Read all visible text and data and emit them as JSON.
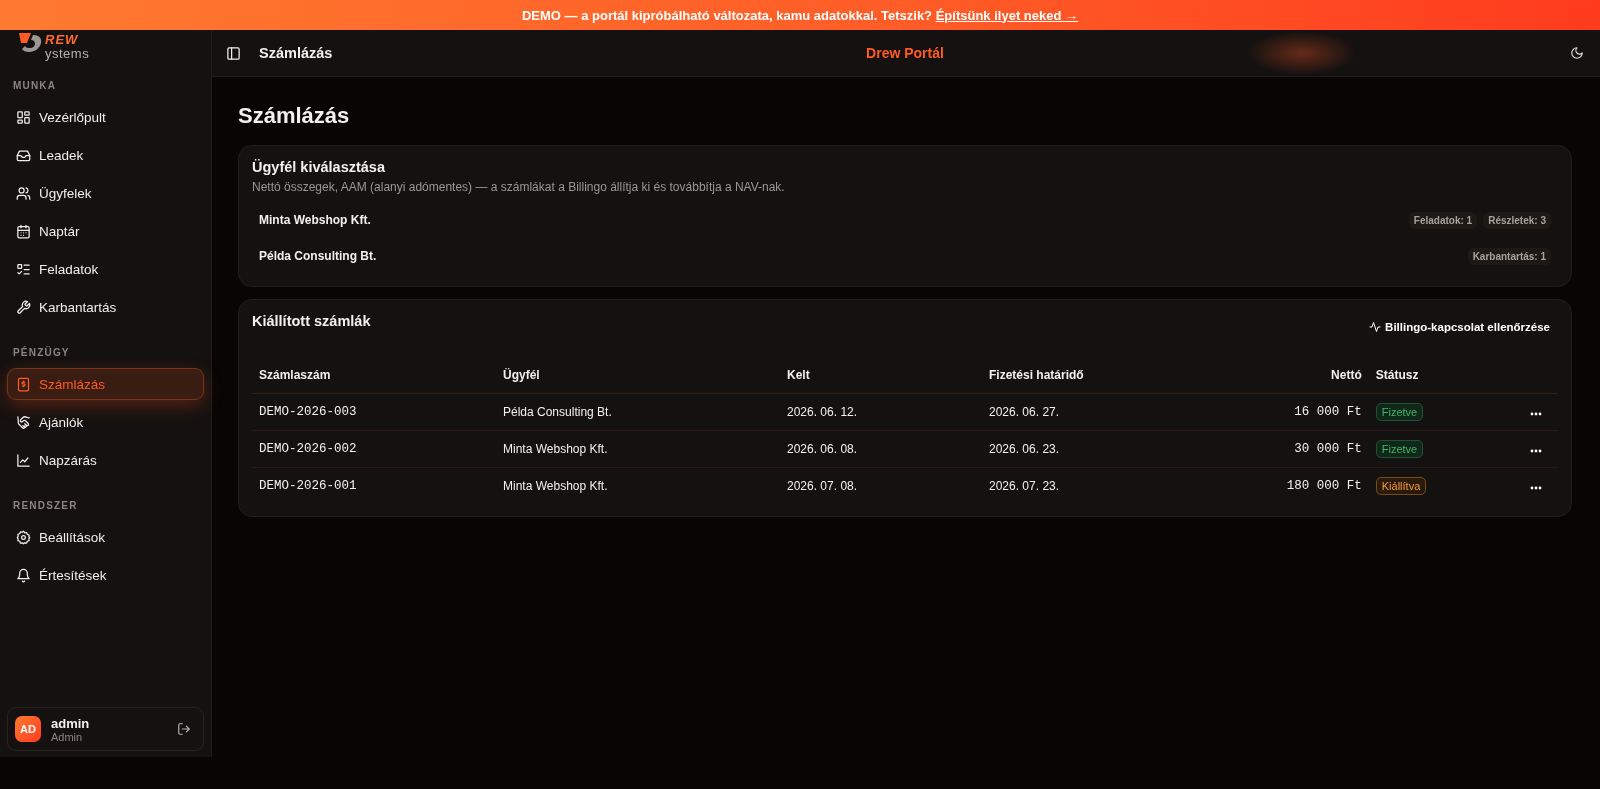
{
  "banner": {
    "text": "DEMO — a portál kipróbálható változata, kamu adatokkal. Tetszik? ",
    "link": "Építsünk ilyet neked →"
  },
  "logo": {
    "mark": "REW",
    "sub": "ystems"
  },
  "sidebar": {
    "sections": [
      {
        "title": "MUNKA",
        "items": [
          {
            "label": "Vezérlőpult",
            "selected": false
          },
          {
            "label": "Leadek",
            "selected": false
          },
          {
            "label": "Ügyfelek",
            "selected": false
          },
          {
            "label": "Naptár",
            "selected": false
          },
          {
            "label": "Feladatok",
            "selected": false
          },
          {
            "label": "Karbantartás",
            "selected": false
          }
        ]
      },
      {
        "title": "PÉNZÜGY",
        "items": [
          {
            "label": "Számlázás",
            "selected": true
          },
          {
            "label": "Ajánlók",
            "selected": false
          },
          {
            "label": "Napzárás",
            "selected": false
          }
        ]
      },
      {
        "title": "RENDSZER",
        "items": [
          {
            "label": "Beállítások",
            "selected": false
          },
          {
            "label": "Értesítések",
            "selected": false
          }
        ]
      }
    ],
    "user": {
      "initials": "AD",
      "name": "admin",
      "role": "Admin"
    }
  },
  "header": {
    "title": "Számlázás",
    "brand": "Drew Portál"
  },
  "page_title": "Számlázás",
  "client_card": {
    "title": "Ügyfél kiválasztása",
    "description": "Nettó összegek, AAM (alanyi adómentes) — a számlákat a Billingo állítja ki és továbbítja a NAV-nak.",
    "clients": [
      {
        "name": "Minta Webshop Kft.",
        "badges": [
          "Feladatok: 1",
          "Részletek: 3"
        ]
      },
      {
        "name": "Példa Consulting Bt.",
        "badges": [
          "Karbantartás: 1"
        ]
      }
    ]
  },
  "invoice_card": {
    "title": "Kiállított számlák",
    "action": "Billingo-kapcsolat ellenőrzése",
    "columns": [
      "Számlaszám",
      "Ügyfél",
      "Kelt",
      "Fizetési határidő",
      "Nettó",
      "Státusz"
    ],
    "rows": [
      {
        "number": "DEMO-2026-003",
        "client": "Példa Consulting Bt.",
        "issued": "2026. 06. 12.",
        "due": "2026. 06. 27.",
        "net": "16 000 Ft",
        "status": {
          "label": "Fizetve",
          "kind": "paid"
        }
      },
      {
        "number": "DEMO-2026-002",
        "client": "Minta Webshop Kft.",
        "issued": "2026. 06. 08.",
        "due": "2026. 06. 23.",
        "net": "30 000 Ft",
        "status": {
          "label": "Fizetve",
          "kind": "paid"
        }
      },
      {
        "number": "DEMO-2026-001",
        "client": "Minta Webshop Kft.",
        "issued": "2026. 07. 08.",
        "due": "2026. 07. 23.",
        "net": "180 000 Ft",
        "status": {
          "label": "Kiállítva",
          "kind": "issued"
        }
      }
    ]
  }
}
